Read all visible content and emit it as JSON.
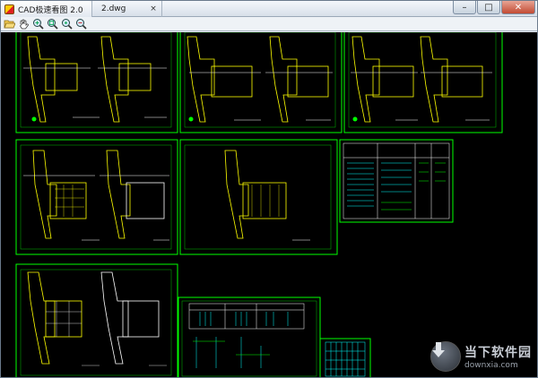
{
  "window": {
    "app_tab_title": "CAD极速看图 2.0",
    "file_tab_title": "2.dwg",
    "tab_close_glyph": "×",
    "minimize_glyph": "–",
    "maximize_glyph": "□",
    "close_glyph": "✕"
  },
  "toolbar": {
    "buttons": [
      {
        "name": "open-file-icon"
      },
      {
        "name": "pan-icon"
      },
      {
        "name": "zoom-in-icon"
      },
      {
        "name": "zoom-extents-icon"
      },
      {
        "name": "zoom-window-icon"
      },
      {
        "name": "zoom-out-icon"
      }
    ]
  },
  "watermark": {
    "title": "当下软件园",
    "url": "downxia.com"
  },
  "colors": {
    "canvas_bg": "#000000",
    "frame_green": "#00ff00",
    "drawing_yellow": "#ffff00",
    "drawing_white": "#ffffff",
    "drawing_cyan": "#00ffff"
  }
}
